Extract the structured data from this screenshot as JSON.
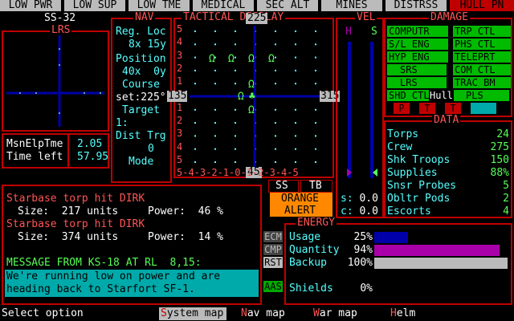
{
  "status_bar": {
    "items": [
      "LOW PWR",
      "LOW SUP",
      "LOW TME",
      "MEDICAL",
      "SEC ALT",
      "MINES",
      "DISTRSS",
      "HULL PN"
    ],
    "alert_index": 7
  },
  "ship_id": "SS-32",
  "lrs": {
    "title": "LRS"
  },
  "mission": {
    "elapsed_label": "MsnElpTme",
    "elapsed_value": "2.05",
    "left_label": "Time left",
    "left_value": "57.95"
  },
  "nav": {
    "title": "NAV",
    "reg_label": "Reg. Loc",
    "reg_value": "8x 15y",
    "pos_label": "Position",
    "pos_value": "40x  0y",
    "course_label": "Course",
    "course_set": "set:225°",
    "target_label": "Target",
    "target_value": "1:",
    "dist_label": "Dist Trg",
    "dist_value": "0",
    "mode_label": "Mode"
  },
  "tactical": {
    "title": "TACTICAL DISPLAY",
    "heading_top": "225",
    "heading_bottom": "45",
    "heading_left": "135",
    "heading_right": "315",
    "row_numbers": [
      "5",
      "4",
      "3",
      "2",
      "1",
      "0",
      "1",
      "2",
      "3",
      "4",
      "5"
    ],
    "bottom_scale": "5-4-3-2-1-0-1-2-3-4-5",
    "contacts_symbol": "Ω",
    "ship_symbol": "♣"
  },
  "vel": {
    "title": "VEL",
    "h_label": "H",
    "s_label": "S",
    "s_value_label": "s:",
    "s_value": "0.0",
    "c_value_label": "c:",
    "c_value": "0.0"
  },
  "damage": {
    "title": "DAMAGE",
    "left": [
      "COMPUTR",
      "S/L ENG",
      "HYP ENG",
      "SRS",
      "LRS",
      "SHD CTL"
    ],
    "right": [
      "TRP CTL",
      "PHS CTL",
      "TELEPRT",
      "COM CTL",
      "TRAC BM",
      "PLS"
    ],
    "hull_label": "Hull",
    "markers": [
      "P",
      "T",
      "T"
    ]
  },
  "data": {
    "title": "DATA",
    "rows": [
      {
        "label": "Torps",
        "value": "24"
      },
      {
        "label": "Crew",
        "value": "275"
      },
      {
        "label": "Shk Troops",
        "value": "150"
      },
      {
        "label": "Supplies",
        "value": "88%"
      },
      {
        "label": "Snsr Probes",
        "value": "5"
      },
      {
        "label": "Obltr Pods",
        "value": "2"
      },
      {
        "label": "Escorts",
        "value": "4"
      }
    ]
  },
  "small_buttons": {
    "ss": "SS",
    "tb": "TB",
    "alert_line1": "ORANGE",
    "alert_line2": "ALERT"
  },
  "side_buttons": {
    "ecm": "ECM",
    "cmp": "CMP",
    "rst": "RST",
    "aas": "AAS"
  },
  "messages": {
    "line1": "Starbase torp hit DIRK",
    "size_label": "Size:",
    "size1": "217 units",
    "power_label": "Power:",
    "power1": "46 %",
    "line2": "Starbase torp hit DIRK",
    "size2": "374 units",
    "power2": "14 %",
    "msg_header": "MESSAGE FROM KS-18 AT RL  8,15:",
    "msg_body1": "We're running low on power and are",
    "msg_body2": "heading back to Starfort SF-1."
  },
  "energy": {
    "title": "ENERGY",
    "rows": [
      {
        "label": "Usage",
        "pct": "25%",
        "fraction": 0.25,
        "color": "#0000aa"
      },
      {
        "label": "Quantity",
        "pct": "94%",
        "fraction": 0.94,
        "color": "#aa00aa"
      },
      {
        "label": "Backup",
        "pct": "100%",
        "fraction": 1.0,
        "color": "#bbbbbb"
      }
    ],
    "shields_label": "Shields",
    "shields_pct": "0%"
  },
  "prompt": "Select option",
  "menu": [
    "System map",
    "Nav map",
    "War map",
    "Helm"
  ]
}
